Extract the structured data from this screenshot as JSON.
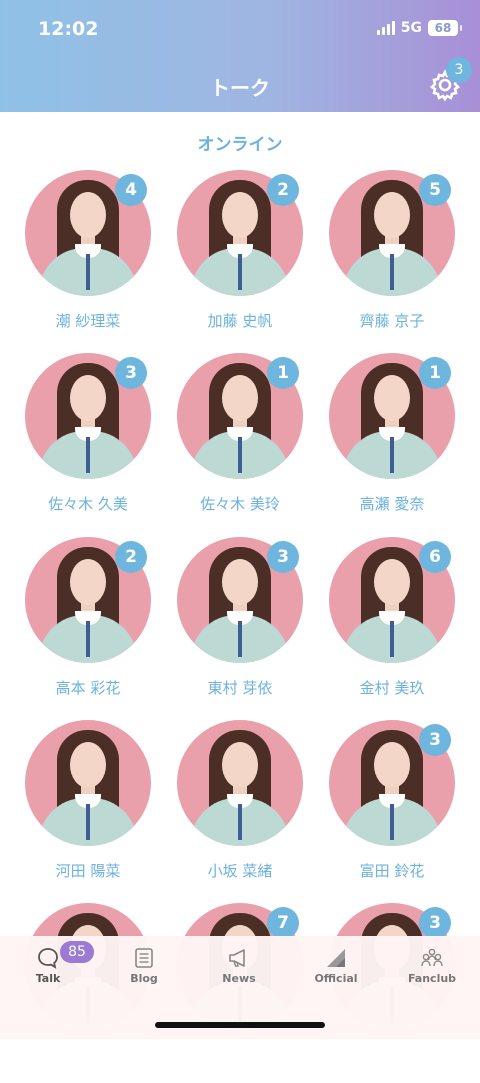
{
  "status_bar": {
    "time": "12:02",
    "network": "5G",
    "battery": "68"
  },
  "header": {
    "title": "トーク",
    "settings_badge": "3"
  },
  "section": {
    "title": "オンライン"
  },
  "members": [
    {
      "name": "潮 紗理菜",
      "badge": "4"
    },
    {
      "name": "加藤 史帆",
      "badge": "2"
    },
    {
      "name": "齊藤 京子",
      "badge": "5"
    },
    {
      "name": "佐々木 久美",
      "badge": "3"
    },
    {
      "name": "佐々木 美玲",
      "badge": "1"
    },
    {
      "name": "高瀬 愛奈",
      "badge": "1"
    },
    {
      "name": "高本 彩花",
      "badge": "2"
    },
    {
      "name": "東村 芽依",
      "badge": "3"
    },
    {
      "name": "金村 美玖",
      "badge": "6"
    },
    {
      "name": "河田 陽菜",
      "badge": ""
    },
    {
      "name": "小坂 菜緒",
      "badge": ""
    },
    {
      "name": "富田 鈴花",
      "badge": "3"
    },
    {
      "name": "",
      "badge": ""
    },
    {
      "name": "",
      "badge": "7"
    },
    {
      "name": "",
      "badge": "3"
    }
  ],
  "tabbar": {
    "talk_badge": "85",
    "tabs": [
      {
        "label": "Talk",
        "icon": "speech-bubble-icon"
      },
      {
        "label": "Blog",
        "icon": "document-icon"
      },
      {
        "label": "News",
        "icon": "megaphone-icon"
      },
      {
        "label": "Official",
        "icon": "triangle-logo-icon"
      },
      {
        "label": "Fanclub",
        "icon": "people-group-icon"
      }
    ]
  },
  "colors": {
    "accent": "#6fb6df",
    "header_start": "#8fc1e6",
    "header_end": "#a88fd6",
    "avatar_bg": "#eaa0aa"
  }
}
